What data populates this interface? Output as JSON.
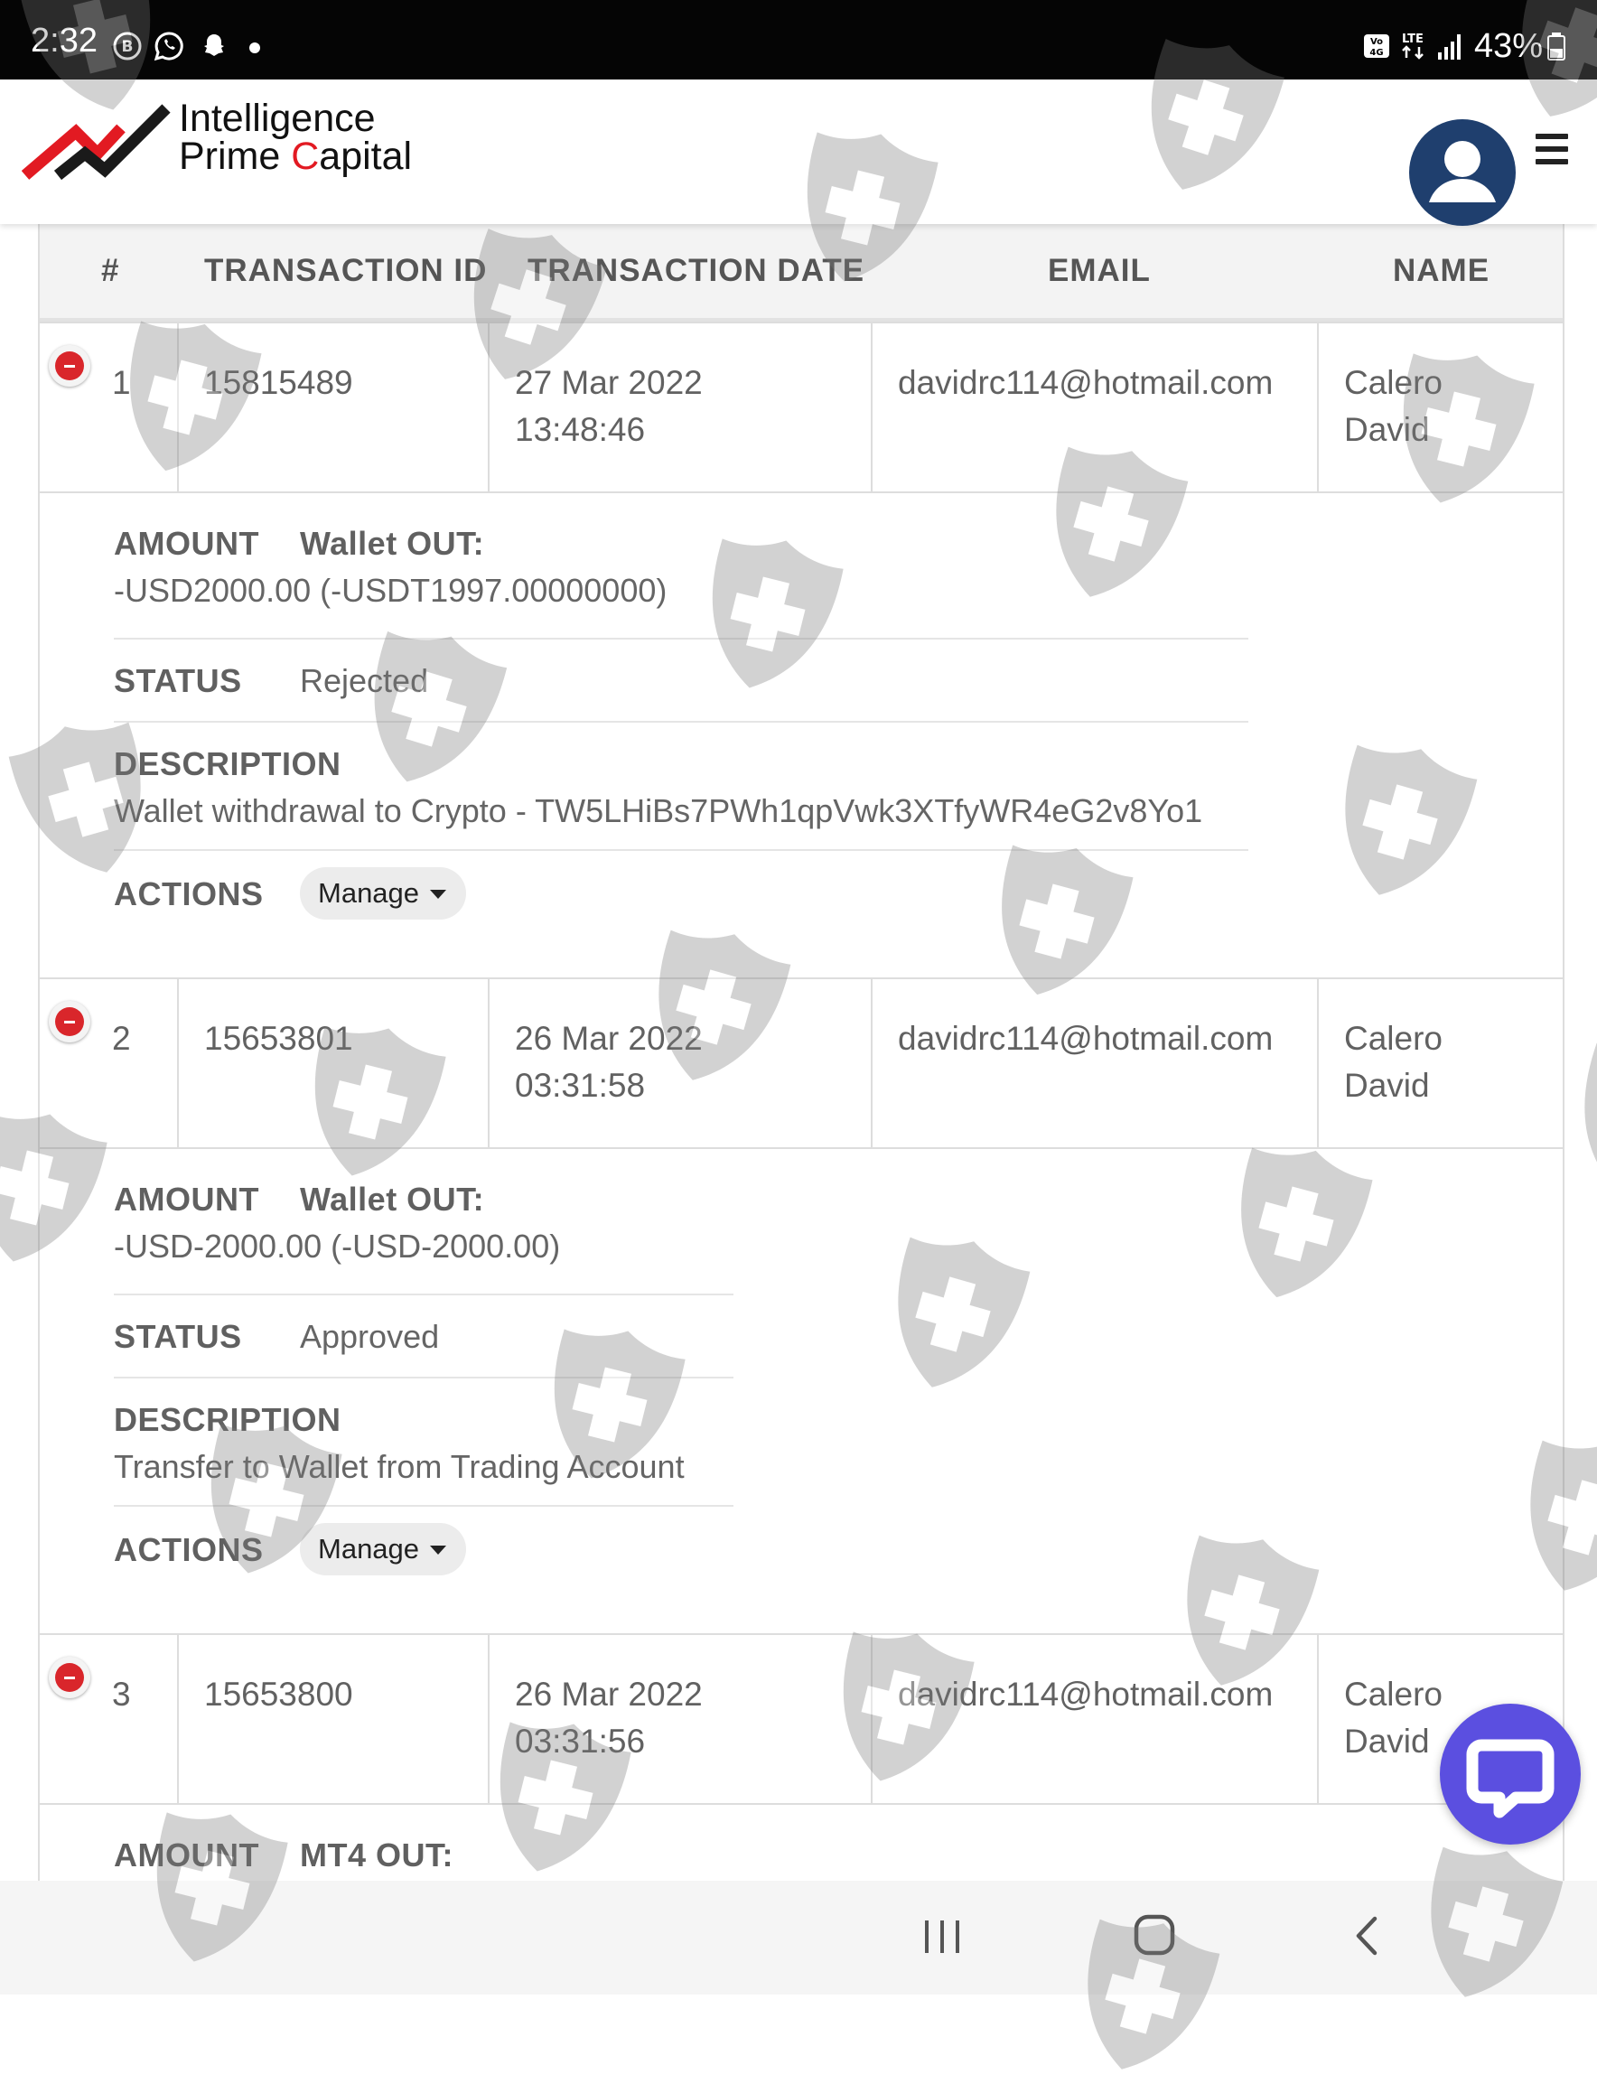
{
  "status_bar": {
    "time": "2:32",
    "network_label": "LTE",
    "volte_label": "VoLTE 4G",
    "battery": "43%"
  },
  "header": {
    "brand_line1": "Intelligence",
    "brand_line2_prefix": "Prime ",
    "brand_line2_accent": "C",
    "brand_line2_suffix": "apital"
  },
  "table": {
    "headers": [
      "#",
      "TRANSACTION ID",
      "TRANSACTION DATE",
      "EMAIL",
      "NAME"
    ],
    "rows": [
      {
        "num": "1",
        "id": "15815489",
        "date_line1": "27 Mar 2022",
        "date_line2": "13:48:46",
        "email": "davidrc114@hotmail.com",
        "name_line1": "Calero",
        "name_line2": "David"
      },
      {
        "num": "2",
        "id": "15653801",
        "date_line1": "26 Mar 2022",
        "date_line2": "03:31:58",
        "email": "davidrc114@hotmail.com",
        "name_line1": "Calero",
        "name_line2": "David"
      },
      {
        "num": "3",
        "id": "15653800",
        "date_line1": "26 Mar 2022",
        "date_line2": "03:31:56",
        "email": "davidrc114@hotmail.com",
        "name_line1": "Calero",
        "name_line2": "David"
      }
    ],
    "details": [
      {
        "amount_label": "AMOUNT",
        "type_label": "Wallet OUT:",
        "amount_value": "-USD2000.00 (-USDT1997.00000000)",
        "status_label": "STATUS",
        "status_value": "Rejected",
        "description_label": "DESCRIPTION",
        "description_value": "Wallet withdrawal to Crypto - TW5LHiBs7PWh1qpVwk3XTfyWR4eG2v8Yo1",
        "actions_label": "ACTIONS",
        "manage_label": "Manage"
      },
      {
        "amount_label": "AMOUNT",
        "type_label": "Wallet OUT:",
        "amount_value": "-USD-2000.00 (-USD-2000.00)",
        "status_label": "STATUS",
        "status_value": "Approved",
        "description_label": "DESCRIPTION",
        "description_value": "Transfer to Wallet from Trading Account",
        "actions_label": "ACTIONS",
        "manage_label": "Manage"
      },
      {
        "amount_label": "AMOUNT",
        "type_label": "MT4 OUT:"
      }
    ]
  },
  "colors": {
    "brand_red": "#e21a22",
    "avatar_blue": "#1f3f6e",
    "chat_purple": "#5b4fe0",
    "delete_red": "#d9262b"
  },
  "icons": {
    "delete": "minus-circle-icon",
    "menu": "hamburger-icon",
    "profile": "user-avatar-icon",
    "chat": "chat-bubble-icon",
    "watermark": "shield-cross-icon"
  }
}
